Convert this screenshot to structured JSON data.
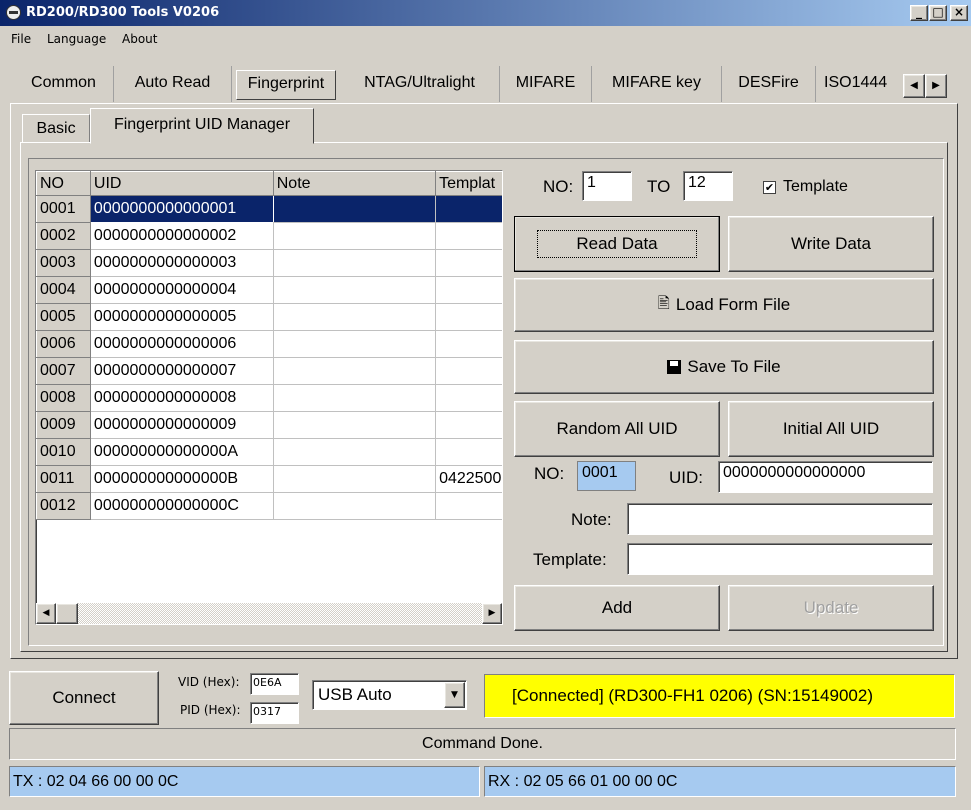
{
  "window": {
    "title": "RD200/RD300 Tools V0206",
    "min": "_",
    "max": "□",
    "close": "×"
  },
  "menu": [
    "File",
    "Language",
    "About"
  ],
  "tabs": [
    "Common",
    "Auto Read",
    "Fingerprint",
    "NTAG/Ultralight",
    "MIFARE",
    "MIFARE key",
    "DESFire",
    "ISO1444"
  ],
  "subtabs": [
    "Basic",
    "Fingerprint UID Manager"
  ],
  "table": {
    "columns": [
      "NO",
      "UID",
      "Note",
      "Templat"
    ],
    "rows": [
      {
        "no": "0001",
        "uid": "0000000000000001",
        "note": "",
        "template": ""
      },
      {
        "no": "0002",
        "uid": "0000000000000002",
        "note": "",
        "template": ""
      },
      {
        "no": "0003",
        "uid": "0000000000000003",
        "note": "",
        "template": ""
      },
      {
        "no": "0004",
        "uid": "0000000000000004",
        "note": "",
        "template": ""
      },
      {
        "no": "0005",
        "uid": "0000000000000005",
        "note": "",
        "template": ""
      },
      {
        "no": "0006",
        "uid": "0000000000000006",
        "note": "",
        "template": ""
      },
      {
        "no": "0007",
        "uid": "0000000000000007",
        "note": "",
        "template": ""
      },
      {
        "no": "0008",
        "uid": "0000000000000008",
        "note": "",
        "template": ""
      },
      {
        "no": "0009",
        "uid": "0000000000000009",
        "note": "",
        "template": ""
      },
      {
        "no": "0010",
        "uid": "000000000000000A",
        "note": "",
        "template": ""
      },
      {
        "no": "0011",
        "uid": "000000000000000B",
        "note": "",
        "template": "0422500"
      },
      {
        "no": "0012",
        "uid": "000000000000000C",
        "note": "",
        "template": ""
      }
    ]
  },
  "range": {
    "no_label": "NO:",
    "from": "1",
    "to_label": "TO",
    "to": "12",
    "template_label": "Template",
    "template_checked": "✔"
  },
  "buttons": {
    "read_data": "Read Data",
    "write_data": "Write Data",
    "load_form_file": "Load Form File",
    "save_to_file": "Save To File",
    "random_all_uid": "Random All UID",
    "initial_all_uid": "Initial All UID",
    "add": "Add",
    "update": "Update"
  },
  "editor": {
    "no_label": "NO:",
    "no": "0001",
    "uid_label": "UID:",
    "uid": "0000000000000000",
    "note_label": "Note:",
    "note": "",
    "template_label": "Template:",
    "template": ""
  },
  "connection": {
    "connect": "Connect",
    "vid_label": "VID (Hex):",
    "vid": "0E6A",
    "pid_label": "PID (Hex):",
    "pid": "0317",
    "mode": "USB Auto",
    "status": "[Connected] (RD300-FH1    0206) (SN:15149002)"
  },
  "command_status": "Command Done.",
  "tx": "TX : 02 04 66 00 00 0C",
  "rx": "RX : 02 05 66 01 00 00 0C",
  "colors": {
    "title_bar": "#0a246a",
    "selection": "#0a246a",
    "status_ok": "#ffff00",
    "txrx": "#a6caf0",
    "no_field": "#a6caf0"
  }
}
